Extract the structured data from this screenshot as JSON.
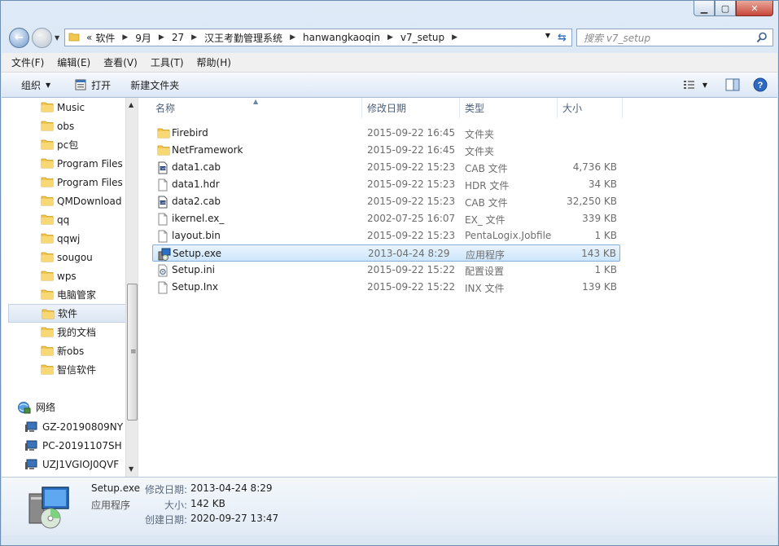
{
  "window": {
    "caption_buttons": [
      "minimize",
      "maximize",
      "close"
    ]
  },
  "address": {
    "chevrons": "«",
    "breadcrumbs": [
      "软件",
      "9月",
      "27",
      "汉王考勤管理系统",
      "hanwangkaoqin",
      "v7_setup"
    ],
    "search_placeholder": "搜索 v7_setup"
  },
  "menu": {
    "items": [
      "文件(F)",
      "编辑(E)",
      "查看(V)",
      "工具(T)",
      "帮助(H)"
    ]
  },
  "toolbar": {
    "organize": "组织",
    "open": "打开",
    "new_folder": "新建文件夹"
  },
  "nav": {
    "folders": [
      "Music",
      "obs",
      "pc包",
      "Program Files",
      "Program Files",
      "QMDownload",
      "qq",
      "qqwj",
      "sougou",
      "wps",
      "电脑管家",
      "软件",
      "我的文档",
      "新obs",
      "智信软件"
    ],
    "selected_index": 11,
    "network_label": "网络",
    "computers": [
      "GZ-20190809NY",
      "PC-20191107SH",
      "UZJ1VGIOJ0QVF"
    ]
  },
  "columns": {
    "name": "名称",
    "date": "修改日期",
    "type": "类型",
    "size": "大小"
  },
  "files": [
    {
      "name": "Firebird",
      "date": "2015-09-22 16:45",
      "type": "文件夹",
      "size": "",
      "icon": "folder-icon"
    },
    {
      "name": "NetFramework",
      "date": "2015-09-22 16:45",
      "type": "文件夹",
      "size": "",
      "icon": "folder-icon"
    },
    {
      "name": "data1.cab",
      "date": "2015-09-22 15:23",
      "type": "CAB 文件",
      "size": "4,736 KB",
      "icon": "cab-file-icon"
    },
    {
      "name": "data1.hdr",
      "date": "2015-09-22 15:23",
      "type": "HDR 文件",
      "size": "34 KB",
      "icon": "file-icon"
    },
    {
      "name": "data2.cab",
      "date": "2015-09-22 15:23",
      "type": "CAB 文件",
      "size": "32,250 KB",
      "icon": "cab-file-icon"
    },
    {
      "name": "ikernel.ex_",
      "date": "2002-07-25 16:07",
      "type": "EX_ 文件",
      "size": "339 KB",
      "icon": "file-icon"
    },
    {
      "name": "layout.bin",
      "date": "2015-09-22 15:23",
      "type": "PentaLogix.Jobfile",
      "size": "1 KB",
      "icon": "file-icon"
    },
    {
      "name": "Setup.exe",
      "date": "2013-04-24 8:29",
      "type": "应用程序",
      "size": "143 KB",
      "icon": "setup-exe-icon"
    },
    {
      "name": "Setup.ini",
      "date": "2015-09-22 15:22",
      "type": "配置设置",
      "size": "1 KB",
      "icon": "settings-file-icon"
    },
    {
      "name": "Setup.Inx",
      "date": "2015-09-22 15:22",
      "type": "INX 文件",
      "size": "139 KB",
      "icon": "file-icon"
    }
  ],
  "selected_file_index": 7,
  "details": {
    "name": "Setup.exe",
    "type": "应用程序",
    "modified_label": "修改日期:",
    "modified_value": "2013-04-24 8:29",
    "size_label": "大小:",
    "size_value": "142 KB",
    "created_label": "创建日期:",
    "created_value": "2020-09-27 13:47"
  },
  "colors": {
    "selection_fill": "#cde6fb",
    "selection_border": "#84acdd",
    "folder_yellow": "#f2c74f",
    "header_text": "#4c607a"
  }
}
